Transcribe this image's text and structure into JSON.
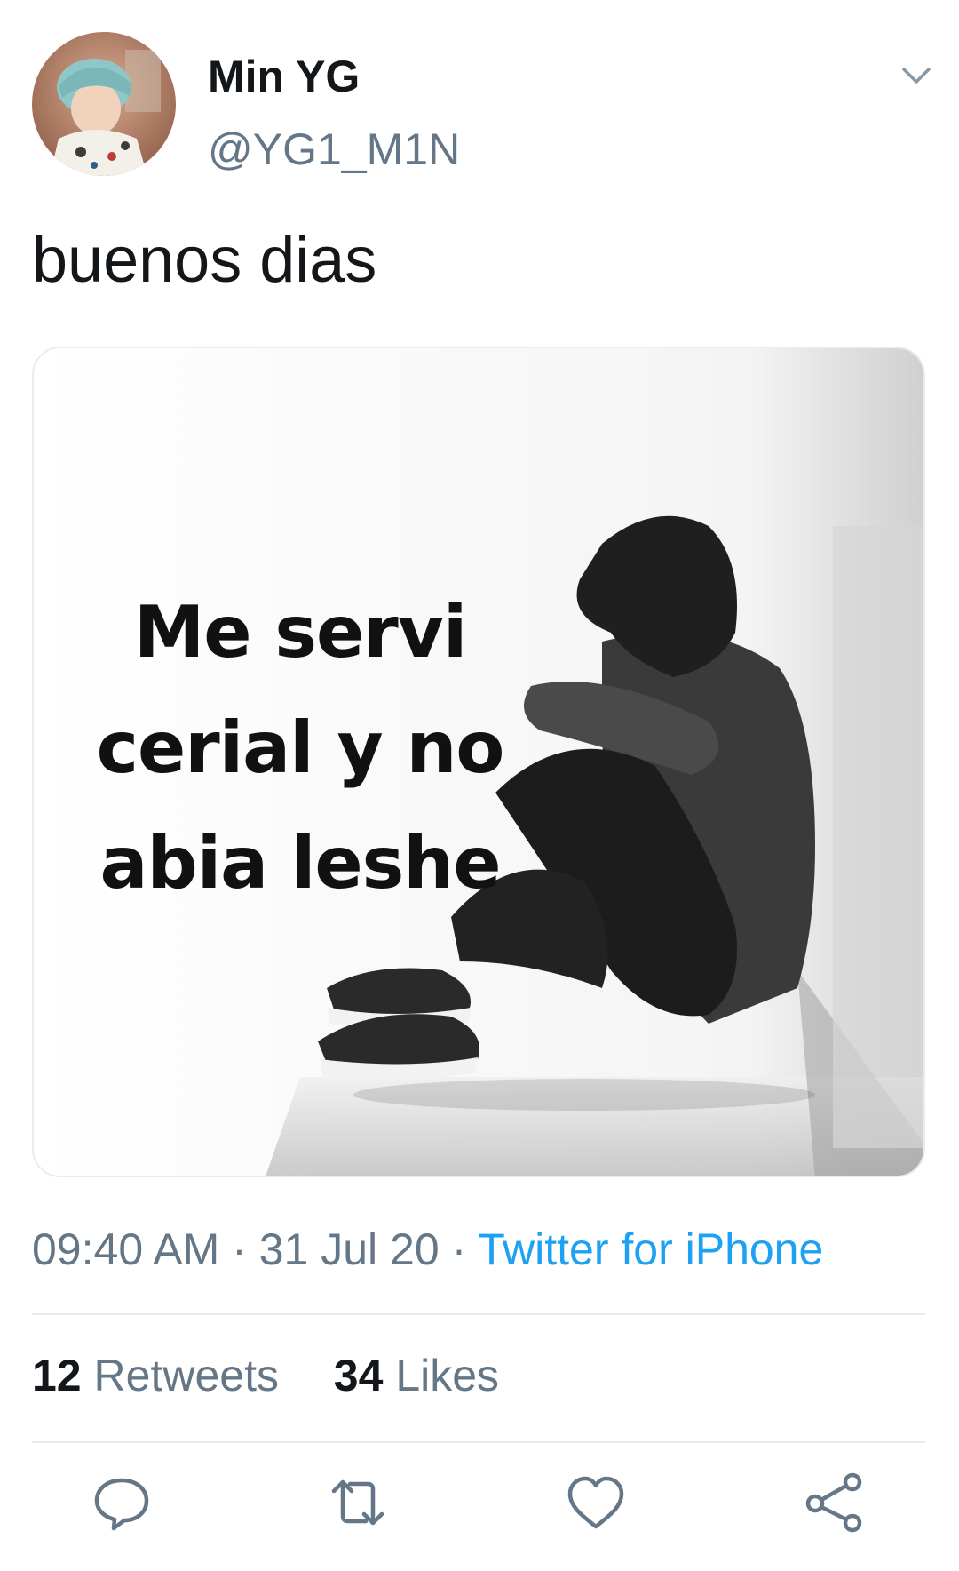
{
  "user": {
    "display_name": "Min YG",
    "handle": "@YG1_M1N"
  },
  "tweet": {
    "text": "buenos dias",
    "media": {
      "caption_lines": [
        "Me servi",
        "cerial y no",
        "abia leshe"
      ]
    },
    "time": "09:40 AM",
    "separator": "·",
    "date": "31 Jul 20",
    "source": "Twitter for iPhone"
  },
  "stats": {
    "retweets": {
      "count": "12",
      "label": "Retweets"
    },
    "likes": {
      "count": "34",
      "label": "Likes"
    }
  },
  "icons": {
    "menu": "chevron-down-icon",
    "reply": "reply-icon",
    "retweet": "retweet-icon",
    "like": "heart-icon",
    "share": "share-icon"
  },
  "colors": {
    "text": "#14171a",
    "secondary": "#657786",
    "link": "#1da1f2",
    "divider": "#e6ecf0"
  }
}
